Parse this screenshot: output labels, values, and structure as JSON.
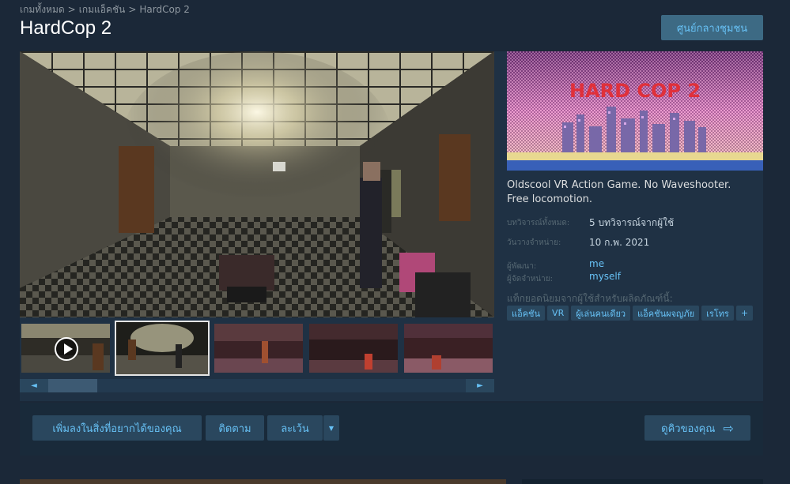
{
  "breadcrumb": [
    "เกมทั้งหมด",
    "เกมแอ็คชัน",
    "HardCop 2"
  ],
  "breadcrumb_sep": ">",
  "title": "HardCop 2",
  "community_hub": "ศูนย์กลางชุมชน",
  "capsule_title": "HARD COP 2",
  "description": "Oldscool VR Action Game. No Waveshooter. Free locomotion.",
  "info": {
    "reviews_label": "บทวิจารณ์ทั้งหมด:",
    "reviews_value": "5 บทวิจารณ์จากผู้ใช้",
    "release_label": "วันวางจำหน่าย:",
    "release_value": "10 ก.พ. 2021",
    "developer_label": "ผู้พัฒนา:",
    "developer_value": "me",
    "publisher_label": "ผู้จัดจำหน่าย:",
    "publisher_value": "myself"
  },
  "tags_label": "แท็กยอดนิยมจากผู้ใช้สำหรับผลิตภัณฑ์นี้:",
  "tags": [
    "แอ็คชัน",
    "VR",
    "ผู้เล่นคนเดียว",
    "แอ็คชันผจญภัย",
    "เรโทร",
    "+"
  ],
  "scroll": {
    "left_arrow": "◄",
    "right_arrow": "►"
  },
  "actions": {
    "wishlist": "เพิ่มลงในสิ่งที่อยากได้ของคุณ",
    "follow": "ติดตาม",
    "ignore": "ละเว้น",
    "dropdown": "▼",
    "queue": "ดูคิวของคุณ",
    "queue_arrow": "⇨"
  },
  "colors": {
    "accent": "#67c1f5",
    "background": "#1b2838",
    "button": "#2a475e"
  }
}
